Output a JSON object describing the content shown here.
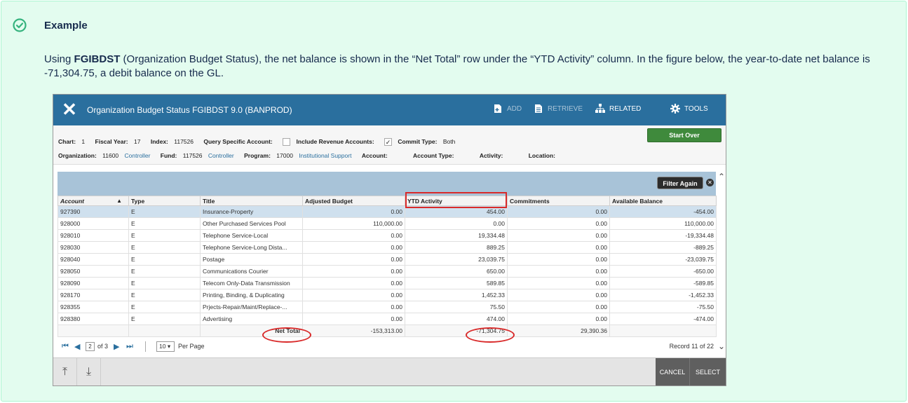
{
  "panel": {
    "title": "Example",
    "text_before": "Using ",
    "text_bold": "FGIBDST",
    "text_after": " (Organization Budget Status), the net balance is shown in the “Net Total” row under the “YTD Activity” column. In the figure below, the year-to-date net balance is -71,304.75, a debit balance on the GL.",
    "accent_color": "#36b37e"
  },
  "app": {
    "title": "Organization Budget Status FGIBDST 9.0 (BANPROD)",
    "toolbar": {
      "add": "ADD",
      "retrieve": "RETRIEVE",
      "related": "RELATED",
      "tools": "TOOLS"
    },
    "criteria": {
      "chart_label": "Chart:",
      "chart_value": "1",
      "fiscal_label": "Fiscal Year:",
      "fiscal_value": "17",
      "index_label": "Index:",
      "index_value": "117526",
      "query_label": "Query Specific Account:",
      "revenue_label": "Include Revenue Accounts:",
      "commit_label": "Commit Type:",
      "commit_value": "Both",
      "org_label": "Organization:",
      "org_value": "11600",
      "org_name": "Controller",
      "fund_label": "Fund:",
      "fund_value": "117526",
      "fund_name": "Controller",
      "program_label": "Program:",
      "program_value": "17000",
      "program_name": "Institutional Support",
      "account_label": "Account:",
      "account_type_label": "Account Type:",
      "activity_label": "Activity:",
      "location_label": "Location:"
    },
    "start_over": "Start Over",
    "filter_again": "Filter Again",
    "columns": [
      "Account",
      "Type",
      "Title",
      "Adjusted Budget",
      "YTD Activity",
      "Commitments",
      "Available Balance"
    ],
    "rows": [
      [
        "927390",
        "E",
        "Insurance-Property",
        "0.00",
        "454.00",
        "0.00",
        "-454.00"
      ],
      [
        "928000",
        "E",
        "Other Purchased Services Pool",
        "110,000.00",
        "0.00",
        "0.00",
        "110,000.00"
      ],
      [
        "928010",
        "E",
        "Telephone Service-Local",
        "0.00",
        "19,334.48",
        "0.00",
        "-19,334.48"
      ],
      [
        "928030",
        "E",
        "Telephone Service-Long Dista...",
        "0.00",
        "889.25",
        "0.00",
        "-889.25"
      ],
      [
        "928040",
        "E",
        "Postage",
        "0.00",
        "23,039.75",
        "0.00",
        "-23,039.75"
      ],
      [
        "928050",
        "E",
        "Communications Courier",
        "0.00",
        "650.00",
        "0.00",
        "-650.00"
      ],
      [
        "928090",
        "E",
        "Telecom Only-Data Transmission",
        "0.00",
        "589.85",
        "0.00",
        "-589.85"
      ],
      [
        "928170",
        "E",
        "Printing, Binding, & Duplicating",
        "0.00",
        "1,452.33",
        "0.00",
        "-1,452.33"
      ],
      [
        "928355",
        "E",
        "Prjects-Repair/Maint/Replace-...",
        "0.00",
        "75.50",
        "0.00",
        "-75.50"
      ],
      [
        "928380",
        "E",
        "Advertising",
        "0.00",
        "474.00",
        "0.00",
        "-474.00"
      ]
    ],
    "total": {
      "label": "Net Total",
      "adjusted_budget": "-153,313.00",
      "ytd_activity": "-71,304.75",
      "commitments": "29,390.36"
    },
    "pager": {
      "current_page": "2",
      "of_pages": "of 3",
      "per_page_value": "10",
      "per_page_label": "Per Page",
      "record": "Record 11 of 22"
    },
    "bottom": {
      "cancel": "CANCEL",
      "select": "SELECT"
    },
    "colors": {
      "header": "#2a6f9e",
      "highlight": "#d92a2a",
      "selected_row": "#cfe0ee",
      "start_over": "#3f8a3c"
    }
  }
}
